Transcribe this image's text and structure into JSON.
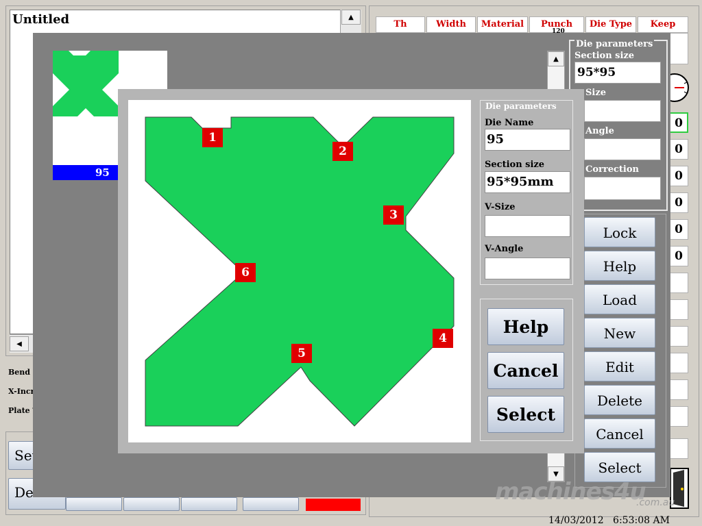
{
  "background": {
    "title": "Untitled",
    "info_labels": [
      "Bend C",
      "X-Incr",
      "Plate T"
    ],
    "bottom_buttons": [
      "Set",
      "De"
    ],
    "table_headers": [
      "Th",
      "Width",
      "Material",
      "Punch Type",
      "Die Type",
      "Keep Time"
    ],
    "table_overflow_text": "120",
    "number_cells": [
      "0",
      "0",
      "0",
      "0",
      "0",
      "0"
    ],
    "datetime": "14/03/2012   6:53:08 AM",
    "watermark": "machines4u",
    "watermark_domain": ".com.au"
  },
  "die_library": {
    "thumbnail_label": "95",
    "panel_title": "Die parameters",
    "section_size_label": "Section size",
    "section_size_value": "95*95",
    "size_label": "Size",
    "angle_label": "Angle",
    "correction_label": "Correction",
    "buttons": [
      "Lock",
      "Help",
      "Load",
      "New",
      "Edit",
      "Delete",
      "Cancel",
      "Select"
    ]
  },
  "die_select": {
    "panel_title": "Die parameters",
    "die_name_label": "Die Name",
    "die_name_value": "95",
    "section_size_label": "Section size",
    "section_size_value": "95*95mm",
    "v_size_label": "V-Size",
    "v_size_value": "",
    "v_angle_label": "V-Angle",
    "v_angle_value": "",
    "help_label": "Help",
    "cancel_label": "Cancel",
    "select_label": "Select",
    "markers": [
      "1",
      "2",
      "3",
      "4",
      "5",
      "6"
    ],
    "shape_color": "#1ad05a",
    "marker_color": "#e00000"
  }
}
